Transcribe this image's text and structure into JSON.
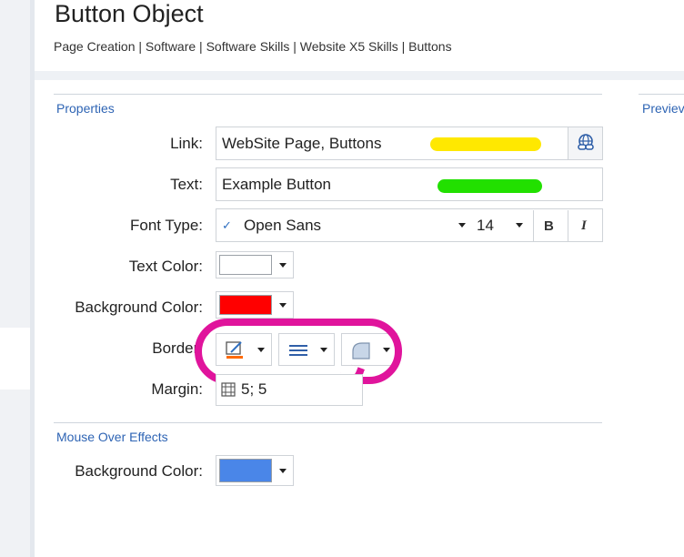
{
  "page": {
    "title": "Button Object",
    "breadcrumb": "Page Creation | Software | Software Skills | Website X5 Skills | Buttons"
  },
  "properties": {
    "section_title": "Properties",
    "link": {
      "label": "Link:",
      "value": "WebSite Page, Buttons",
      "icon": "link-globe-icon"
    },
    "text": {
      "label": "Text:",
      "value": "Example Button"
    },
    "font": {
      "label": "Font Type:",
      "check": "✓",
      "value": "Open Sans",
      "size": "14",
      "bold": "B",
      "italic": "I"
    },
    "text_color": {
      "label": "Text Color:",
      "color": "#ffffff"
    },
    "background_color": {
      "label": "Background Color:",
      "color": "#ff0000"
    },
    "border": {
      "label": "Border:",
      "buttons": [
        "border-color-icon",
        "border-style-icon",
        "border-corner-icon"
      ]
    },
    "margin": {
      "label": "Margin:",
      "value": "5; 5"
    }
  },
  "mouse_over": {
    "section_title": "Mouse Over Effects",
    "background_color": {
      "label": "Background Color:",
      "color": "#4a86e8"
    }
  },
  "preview": {
    "section_title": "Previev"
  },
  "annotations": {
    "yellow": "#ffe800",
    "green": "#22e000",
    "magenta": "#e0149c"
  }
}
